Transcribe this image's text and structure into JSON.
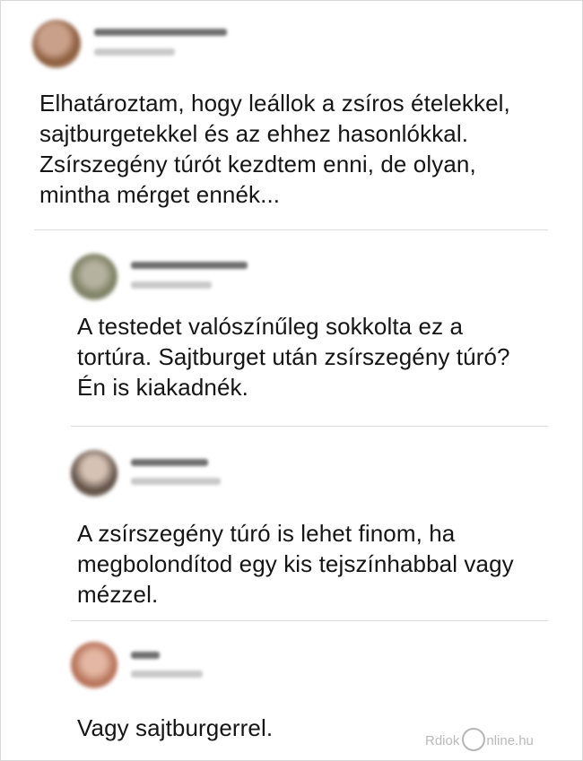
{
  "thread": {
    "main_post": {
      "text": "Elhatároztam, hogy leállok a zsíros ételekkel, sajtburgetekkel és az ehhez hasonlókkal. Zsírszegény túrót kezdtem enni, de olyan, mintha mérget ennék..."
    },
    "replies": [
      {
        "text": "A testedet valószínűleg sokkolta ez a tortúra. Sajtburget után zsírszegény túró? Én is kiakadnék."
      },
      {
        "text": "A zsírszegény túró is lehet finom, ha megbolondítod egy kis tejszínhabbal vagy mézzel."
      },
      {
        "text": "Vagy sajtburgerrel."
      }
    ]
  },
  "watermark": {
    "left": "Rdiok",
    "right": "nline.hu"
  },
  "colors": {
    "text": "#151515",
    "divider": "#dcdcdc",
    "watermark": "#b9b9b9"
  }
}
